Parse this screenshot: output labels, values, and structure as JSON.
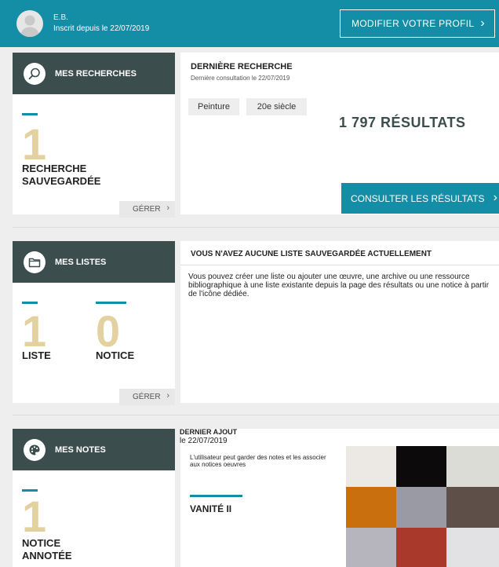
{
  "header": {
    "user_name": "E.B.",
    "user_since": "Inscrit depuis le 22/07/2019",
    "profile_button": "MODIFIER VOTRE PROFIL",
    "chevron": "›"
  },
  "searches": {
    "section_label": "MES RECHERCHES",
    "count": "1",
    "count_label_line1": "RECHERCHE",
    "count_label_line2": "SAUVEGARDÉE",
    "manage_button": "GÉRER",
    "last": {
      "title": "DERNIÈRE RECHERCHE",
      "subtitle": "Dernière consultation le 22/07/2019",
      "tags": [
        "Peinture",
        "20e siècle"
      ],
      "results": "1 797 RÉSULTATS",
      "consult_button": "CONSULTER LES RÉSULTATS"
    }
  },
  "lists": {
    "section_label": "MES LISTES",
    "list_count": "1",
    "list_label": "LISTE",
    "notice_count": "0",
    "notice_label": "NOTICE",
    "manage_button": "GÉRER",
    "empty_title": "VOUS N'AVEZ AUCUNE LISTE SAUVEGARDÉE ACTUELLEMENT",
    "empty_text": "Vous pouvez créer une liste ou ajouter une œuvre, une archive ou une ressource bibliographique à une liste existante depuis la page des résultats ou une notice à partir de l'icône dédiée."
  },
  "notes": {
    "section_label": "MES NOTES",
    "count": "1",
    "count_label_line1": "NOTICE",
    "count_label_line2": "ANNOTÉE",
    "last_title": "DERNIER AJOUT",
    "last_date": "le 22/07/2019",
    "note_text": "L'utilisateur peut garder des notes et les associer aux notices oeuvres",
    "artwork_title": "VANITÉ II",
    "artwork_colors": [
      "#ece9e4",
      "#0c0a0b",
      "#dcdcd7",
      "#c96f0d",
      "#9a9aa4",
      "#5f4f49",
      "#b6b5be",
      "#a8392b",
      "#e2e1e4"
    ]
  },
  "colors": {
    "teal": "#148da6",
    "dark_panel": "#3b4d4c",
    "gold": "#e3d19f"
  },
  "icons": {
    "avatar": "user-avatar-icon",
    "searches": "search-icon",
    "lists": "folder-icon",
    "notes": "palette-icon"
  }
}
